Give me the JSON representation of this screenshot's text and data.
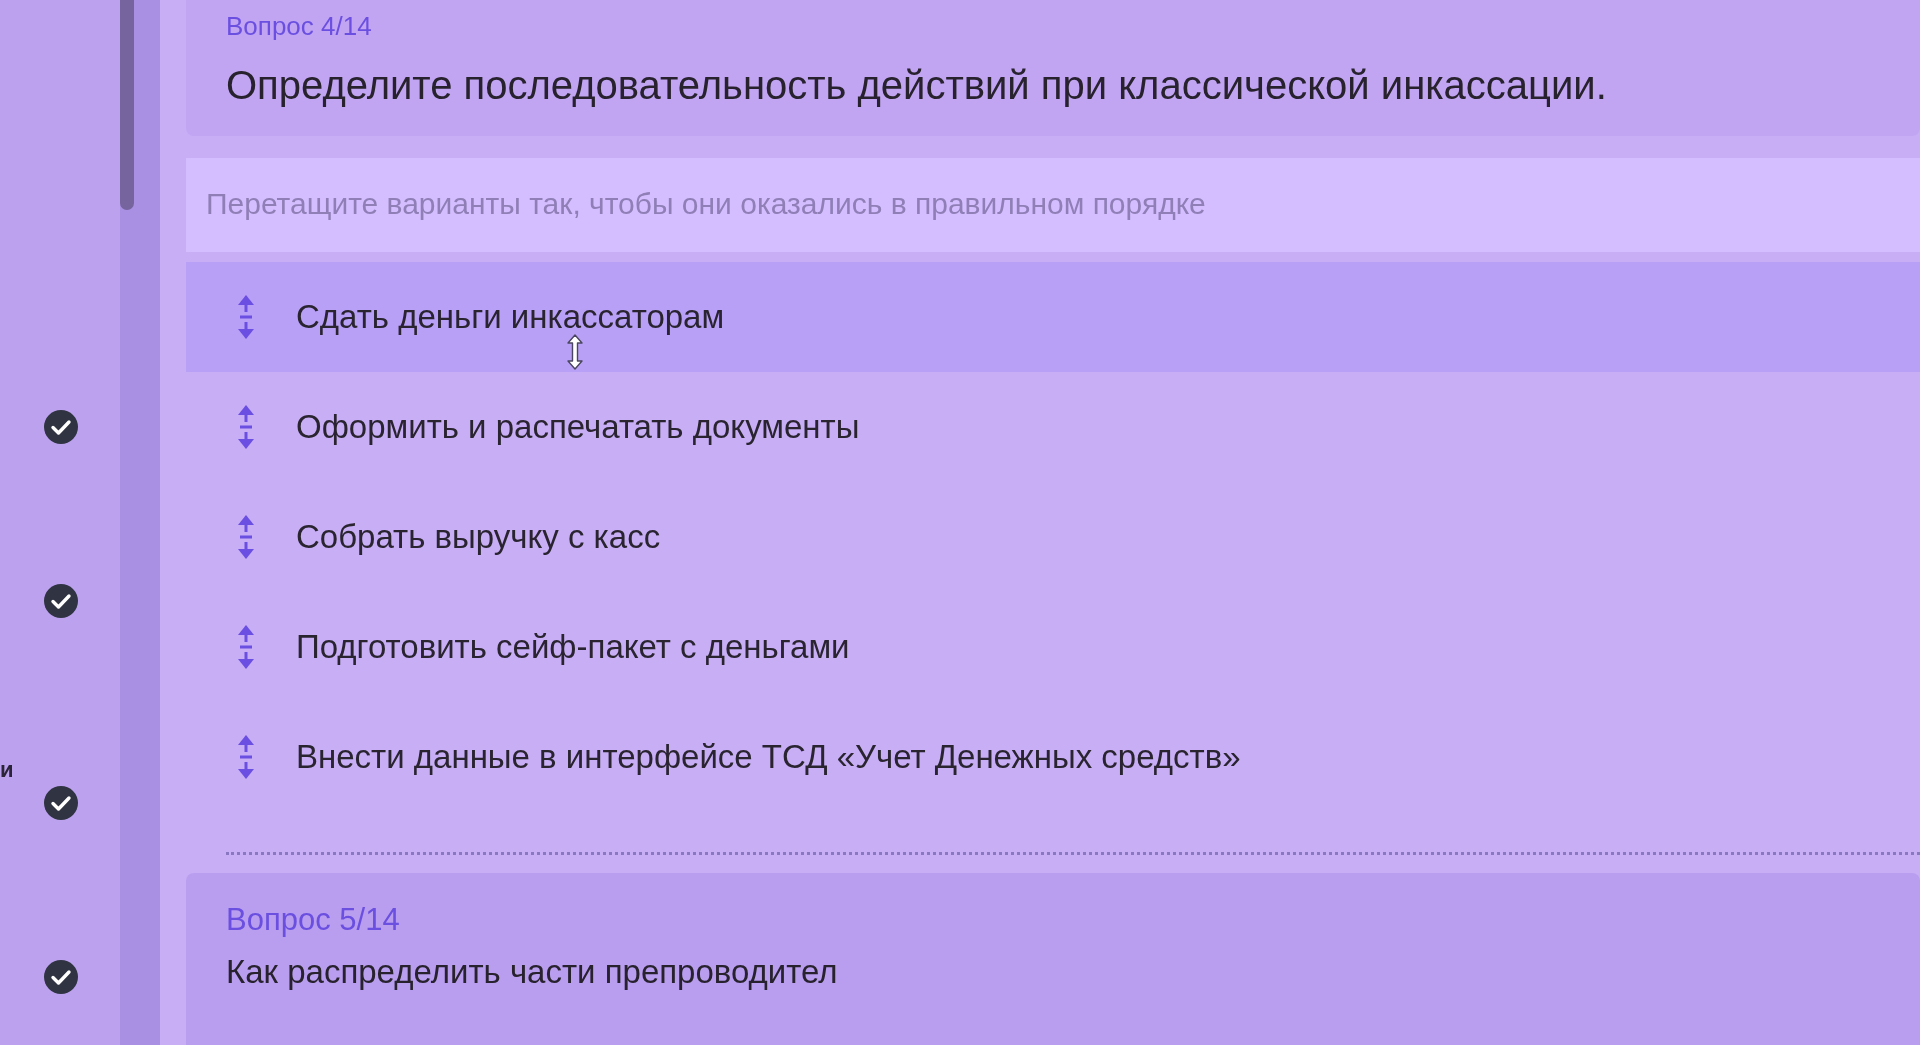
{
  "sidebar": {
    "items": [
      {
        "done": true
      },
      {
        "done": true
      },
      {
        "text": "и",
        "done": true
      },
      {
        "done": true
      }
    ]
  },
  "question": {
    "counter": "Вопрос 4/14",
    "title": "Определите последовательность действий при классической инкассации.",
    "instruction": "Перетащите варианты так, чтобы они оказались в правильном порядке",
    "items": [
      {
        "text": "Сдать деньги инкассаторам",
        "hovered": true
      },
      {
        "text": "Оформить и распечатать документы",
        "hovered": false
      },
      {
        "text": "Собрать выручку с касс",
        "hovered": false
      },
      {
        "text": "Подготовить сейф-пакет с деньгами",
        "hovered": false
      },
      {
        "text": "Внести данные в интерфейсе ТСД «Учет Денежных средств»",
        "hovered": false
      }
    ]
  },
  "next_question": {
    "counter": "Вопрос 5/14",
    "title": "Как распределить части препроводител"
  }
}
